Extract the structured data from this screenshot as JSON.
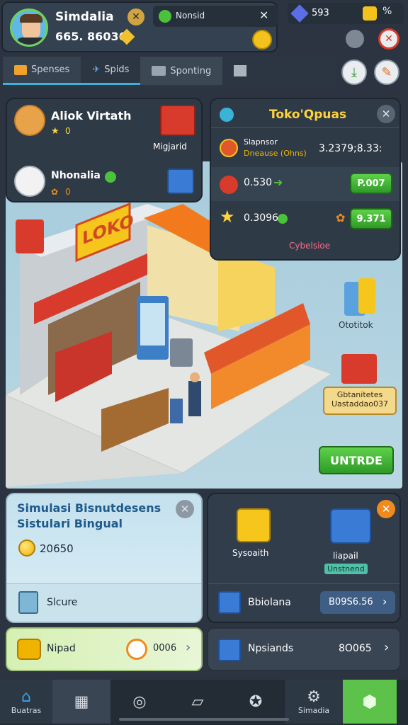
{
  "player": {
    "name": "Simdalia",
    "money": "665. 86036"
  },
  "top_chip": {
    "label": "Nonsid"
  },
  "gems": {
    "value": "593"
  },
  "tabs": [
    {
      "label": "Spenses"
    },
    {
      "label": "Spids"
    },
    {
      "label": "Sponting"
    }
  ],
  "visitors": [
    {
      "name": "Aliok Virtath",
      "stat": "0",
      "item_label": ""
    },
    {
      "name": "Nhonalia",
      "stat": "0",
      "item_label": ""
    }
  ],
  "visitor_item_label": "Migjarid",
  "toko_panel": {
    "title": "Toko'Qpuas",
    "row1_line1": "Slapnsor",
    "row1_line2": "Dneause (Ohns)",
    "row1_value": "3.2379;8.33:",
    "row2_label": "0.530",
    "row2_button": "P.007",
    "row3_label": "0.3096",
    "row3_button": "9.371",
    "footer": "Cybelsioe"
  },
  "scene": {
    "sign": "LOKO",
    "side_item1_label": "Ototitok",
    "side_item2_line1": "Gbtanitetes",
    "side_item2_line2": "Uastaddao037",
    "upgrade_button": "UNTRDE"
  },
  "sim_panel": {
    "title_line1": "Simulasi Bisnutdesens",
    "title_line2": "Sistulari Bingual",
    "coins": "20650",
    "store_label": "Slcure"
  },
  "right_panel": {
    "item1_label": "Sysoaith",
    "item2_label": "liapail",
    "item2_badge": "Unstnend",
    "row_label": "Bbiolana",
    "row_value": "B09S6.56"
  },
  "bottom_left_row": {
    "label": "Nipad",
    "value": "0006"
  },
  "bottom_right_row": {
    "label": "Npsiands",
    "value": "8O065"
  },
  "nav": [
    {
      "label": "Buatras"
    },
    {
      "label": ""
    },
    {
      "label": ""
    },
    {
      "label": ""
    },
    {
      "label": ""
    },
    {
      "label": "Simadia"
    },
    {
      "label": ""
    }
  ],
  "colors": {
    "green": "#4cc23c",
    "orange": "#f08a1c",
    "red": "#d93a2b",
    "blue": "#3a7bd5",
    "yellow": "#ffd43b"
  }
}
